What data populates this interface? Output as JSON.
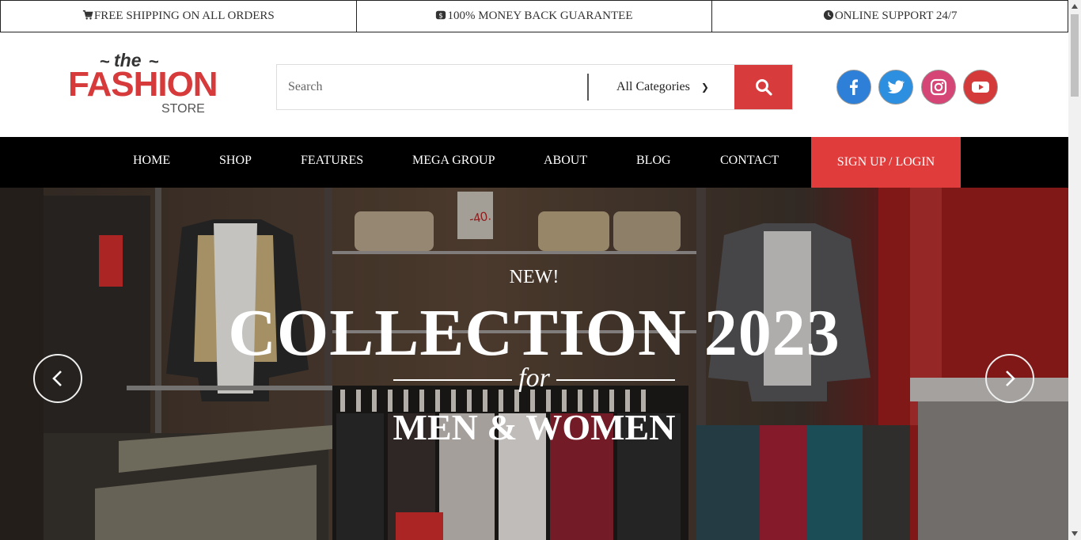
{
  "topbar": {
    "shipping": "FREE SHIPPING ON ALL ORDERS",
    "guarantee": "100% MONEY BACK GUARANTEE",
    "support": "ONLINE SUPPORT 24/7"
  },
  "logo": {
    "the": "the",
    "fashion": "FASHION",
    "store": "STORE"
  },
  "search": {
    "placeholder": "Search",
    "category": "All Categories"
  },
  "social": [
    "facebook-icon",
    "twitter-icon",
    "instagram-icon",
    "youtube-icon"
  ],
  "nav": {
    "items": [
      "HOME",
      "SHOP",
      "FEATURES",
      "MEGA GROUP",
      "ABOUT",
      "BLOG",
      "CONTACT"
    ],
    "login": "SIGN UP / LOGIN"
  },
  "hero": {
    "kicker": "NEW!",
    "headline": "COLLECTION 2023",
    "connector": "for",
    "subline": "MEN & WOMEN"
  },
  "colors": {
    "accent": "#e03c3c",
    "nav_bg": "#000000",
    "facebook": "#2d7fd7",
    "twitter": "#2c8fe0",
    "instagram": "#d54575",
    "youtube": "#d43a3a"
  }
}
